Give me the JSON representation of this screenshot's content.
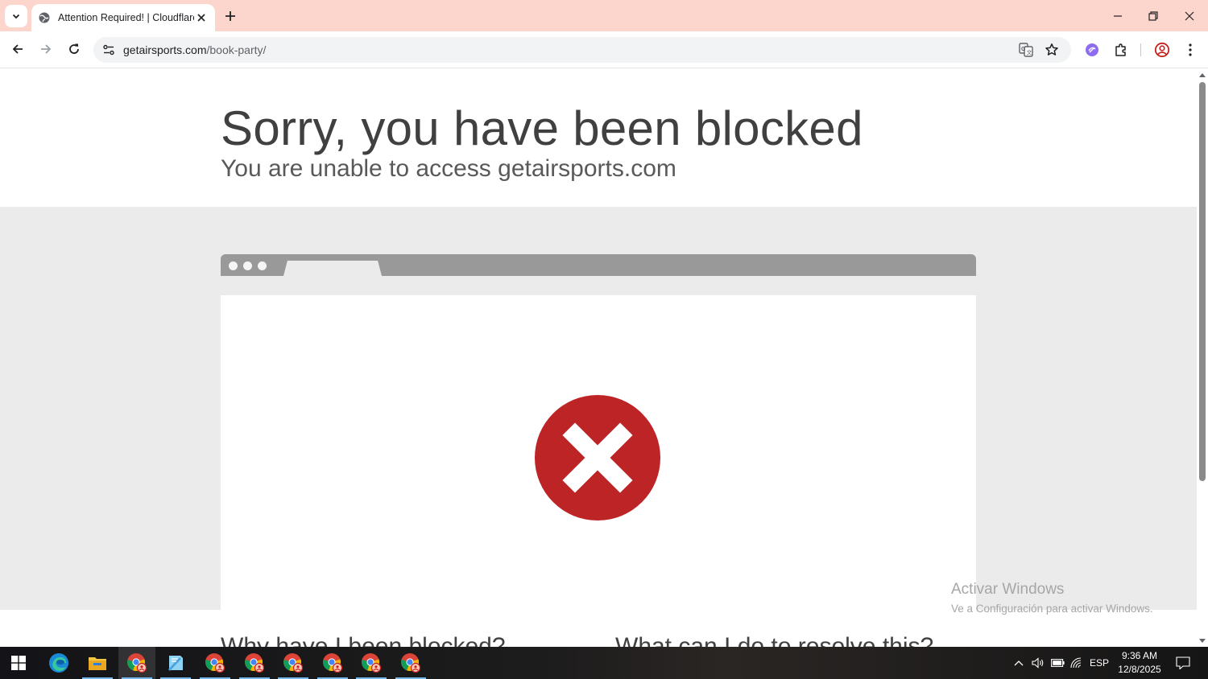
{
  "browser": {
    "tab_title": "Attention Required! | Cloudflare",
    "url_domain": "getairsports.com",
    "url_path": "/book-party/"
  },
  "page": {
    "headline": "Sorry, you have been blocked",
    "subheadline": "You are unable to access getairsports.com",
    "section_left_title": "Why have I been blocked?",
    "section_right_title": "What can I do to resolve this?"
  },
  "watermark": {
    "title": "Activar Windows",
    "subtitle": "Ve a Configuración para activar Windows."
  },
  "taskbar": {
    "language": "ESP",
    "time": "9:36 AM",
    "date": "12/8/2025"
  },
  "colors": {
    "tabstrip": "#fcd5cc",
    "error_red": "#bd2426",
    "content_gray": "#ebebeb"
  }
}
